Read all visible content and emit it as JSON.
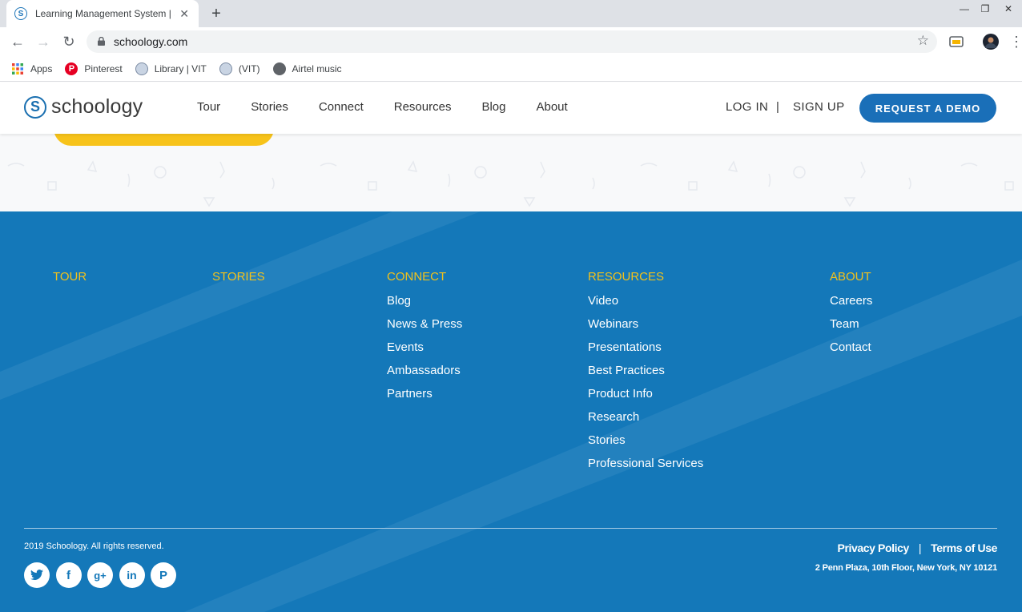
{
  "browser": {
    "tab_title": "Learning Management System | Schoology",
    "tab_close": "✕",
    "new_tab": "+",
    "url": "schoology.com",
    "bookmarks": [
      {
        "label": "Apps",
        "icon": "apps-grid-icon"
      },
      {
        "label": "Pinterest",
        "icon": "pinterest-icon"
      },
      {
        "label": "Library | VIT",
        "icon": "vit-icon"
      },
      {
        "label": "(VIT)",
        "icon": "vit-icon"
      },
      {
        "label": "Airtel music",
        "icon": "globe-icon"
      }
    ]
  },
  "header": {
    "logo_text": "schoology",
    "logo_mark": "S",
    "nav": [
      "Tour",
      "Stories",
      "Connect",
      "Resources",
      "Blog",
      "About"
    ],
    "login": "LOG IN",
    "separator": "|",
    "signup": "SIGN UP",
    "demo": "REQUEST A DEMO"
  },
  "footer": {
    "columns": [
      {
        "heading": "TOUR",
        "links": []
      },
      {
        "heading": "STORIES",
        "links": []
      },
      {
        "heading": "CONNECT",
        "links": [
          "Blog",
          "News & Press",
          "Events",
          "Ambassadors",
          "Partners"
        ]
      },
      {
        "heading": "RESOURCES",
        "links": [
          "Video",
          "Webinars",
          "Presentations",
          "Best Practices",
          "Product Info",
          "Research",
          "Stories",
          "Professional Services"
        ]
      },
      {
        "heading": "ABOUT",
        "links": [
          "Careers",
          "Team",
          "Contact"
        ]
      }
    ],
    "copyright": "2019 Schoology. All rights reserved.",
    "privacy": "Privacy Policy",
    "legal_separator": "|",
    "terms": "Terms of Use",
    "address": "2 Penn Plaza, 10th Floor, New York, NY 10121",
    "social": [
      "twitter-icon",
      "facebook-icon",
      "google-plus-icon",
      "linkedin-icon",
      "pinterest-icon"
    ]
  },
  "colors": {
    "brand_blue": "#1478b9",
    "accent_yellow": "#f3c21a",
    "button_blue": "#1a6fb8"
  }
}
